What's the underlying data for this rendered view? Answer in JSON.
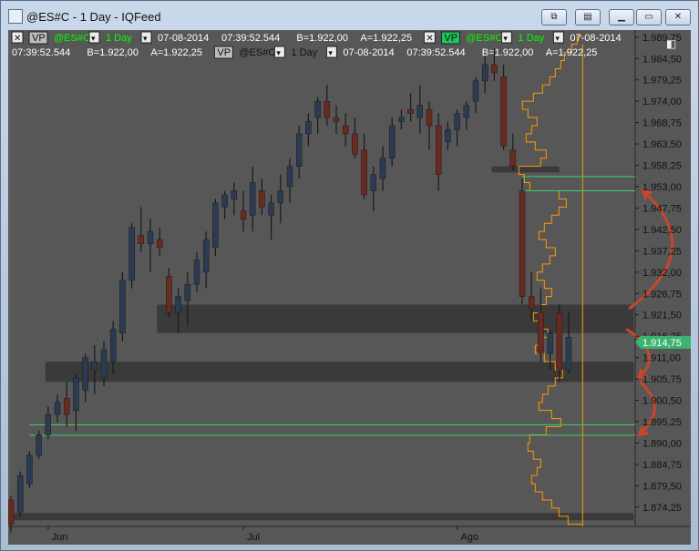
{
  "window": {
    "title": "@ES#C - 1 Day - IQFeed",
    "buttons": [
      "sync-link",
      "toolbar-toggle",
      "minimize",
      "restore",
      "close"
    ]
  },
  "legend": {
    "row1": [
      {
        "kind": "close-box",
        "text": "✕"
      },
      {
        "kind": "badge",
        "text": "VP",
        "style": "gray"
      },
      {
        "kind": "text",
        "text": "@ES#C",
        "color": "#00ff00"
      },
      {
        "kind": "dropdown",
        "text": "▾"
      },
      {
        "kind": "text",
        "text": "1 Day",
        "color": "#00ff00"
      },
      {
        "kind": "dropdown",
        "text": "▾"
      },
      {
        "kind": "text",
        "text": "07-08-2014",
        "color": "#ffffff"
      },
      {
        "kind": "text",
        "text": "07:39:52.544",
        "color": "#ffffff"
      },
      {
        "kind": "text",
        "text": "B=1.922,00",
        "color": "#ffffff"
      },
      {
        "kind": "text",
        "text": "A=1.922,25",
        "color": "#ffffff"
      },
      {
        "kind": "close-box",
        "text": "✕"
      },
      {
        "kind": "badge",
        "text": "VP",
        "style": "green"
      },
      {
        "kind": "text",
        "text": "@ES#C",
        "color": "#00ff00"
      },
      {
        "kind": "dropdown",
        "text": "▾"
      },
      {
        "kind": "text",
        "text": "1 Day",
        "color": "#00ff00"
      },
      {
        "kind": "dropdown",
        "text": "▾"
      },
      {
        "kind": "text",
        "text": "07-08-2014",
        "color": "#ffffff"
      }
    ],
    "row2": [
      {
        "kind": "text",
        "text": "07:39:52.544",
        "color": "#ffffff"
      },
      {
        "kind": "text",
        "text": "B=1.922,00",
        "color": "#ffffff"
      },
      {
        "kind": "text",
        "text": "A=1.922,25",
        "color": "#ffffff"
      },
      {
        "kind": "badge",
        "text": "VP",
        "style": "gray"
      },
      {
        "kind": "text",
        "text": "@ES#C",
        "color": "#111111"
      },
      {
        "kind": "dropdown",
        "text": "▾"
      },
      {
        "kind": "text",
        "text": "1 Day",
        "color": "#111111"
      },
      {
        "kind": "dropdown",
        "text": "▾"
      },
      {
        "kind": "text",
        "text": "07-08-2014",
        "color": "#ffffff"
      },
      {
        "kind": "text",
        "text": "07:39:52.544",
        "color": "#ffffff"
      },
      {
        "kind": "text",
        "text": "B=1.922,00",
        "color": "#ffffff"
      },
      {
        "kind": "text",
        "text": "A=1.922,25",
        "color": "#ffffff"
      }
    ],
    "panel_icon": "split-panel-icon"
  },
  "chart_data": {
    "type": "candlestick",
    "instrument": "@ES#C",
    "interval": "1 Day",
    "ylim": [
      1869.5,
      1991.5
    ],
    "y_ticks": [
      {
        "v": 1989.75,
        "label": "1.989,75"
      },
      {
        "v": 1984.5,
        "label": "1.984,50"
      },
      {
        "v": 1979.25,
        "label": "1.979,25"
      },
      {
        "v": 1974.0,
        "label": "1.974,00"
      },
      {
        "v": 1968.75,
        "label": "1.968,75"
      },
      {
        "v": 1963.5,
        "label": "1.963,50"
      },
      {
        "v": 1958.25,
        "label": "1.958,25"
      },
      {
        "v": 1953.0,
        "label": "1.953,00"
      },
      {
        "v": 1947.75,
        "label": "1.947,75"
      },
      {
        "v": 1942.5,
        "label": "1.942,50"
      },
      {
        "v": 1937.25,
        "label": "1.937,25"
      },
      {
        "v": 1932.0,
        "label": "1.932,00"
      },
      {
        "v": 1926.75,
        "label": "1.926,75"
      },
      {
        "v": 1921.5,
        "label": "1.921,50"
      },
      {
        "v": 1916.25,
        "label": "1.916,25"
      },
      {
        "v": 1911.0,
        "label": "1.911,00"
      },
      {
        "v": 1905.75,
        "label": "1.905,75"
      },
      {
        "v": 1900.5,
        "label": "1.900,50"
      },
      {
        "v": 1895.25,
        "label": "1.895,25"
      },
      {
        "v": 1890.0,
        "label": "1.890,00"
      },
      {
        "v": 1884.75,
        "label": "1.884,75"
      },
      {
        "v": 1879.5,
        "label": "1.879,50"
      },
      {
        "v": 1874.25,
        "label": "1.874,25"
      }
    ],
    "last_price": {
      "value": 1914.75,
      "label": "1.914,75",
      "color": "#3cb371"
    },
    "x_labels": [
      {
        "i": 4,
        "label": "Jun"
      },
      {
        "i": 25,
        "label": "Jul"
      },
      {
        "i": 48,
        "label": "Ago"
      }
    ],
    "candles": [
      [
        1876,
        1877,
        1868,
        1870
      ],
      [
        1873,
        1883,
        1872,
        1882
      ],
      [
        1880,
        1888,
        1879,
        1887
      ],
      [
        1887,
        1893,
        1886,
        1892
      ],
      [
        1892,
        1899,
        1891,
        1897
      ],
      [
        1897,
        1902,
        1895,
        1900
      ],
      [
        1901,
        1905,
        1894,
        1897
      ],
      [
        1898,
        1907,
        1893,
        1906
      ],
      [
        1903,
        1912,
        1900,
        1911
      ],
      [
        1908,
        1914,
        1902,
        1910
      ],
      [
        1906,
        1915,
        1904,
        1913
      ],
      [
        1910,
        1920,
        1907,
        1918
      ],
      [
        1917,
        1932,
        1915,
        1930
      ],
      [
        1930,
        1944,
        1928,
        1943
      ],
      [
        1941,
        1948,
        1937,
        1939
      ],
      [
        1939,
        1945,
        1932,
        1942
      ],
      [
        1940,
        1943,
        1936,
        1938
      ],
      [
        1931,
        1933,
        1921,
        1922
      ],
      [
        1922,
        1928,
        1917,
        1926
      ],
      [
        1925,
        1932,
        1919,
        1929
      ],
      [
        1929,
        1937,
        1927,
        1935
      ],
      [
        1932,
        1942,
        1928,
        1940
      ],
      [
        1938,
        1950,
        1936,
        1949
      ],
      [
        1948,
        1952,
        1945,
        1951
      ],
      [
        1950,
        1954,
        1946,
        1952
      ],
      [
        1947,
        1952,
        1942,
        1945
      ],
      [
        1946,
        1958,
        1942,
        1954
      ],
      [
        1952,
        1955,
        1946,
        1948
      ],
      [
        1946,
        1951,
        1940,
        1949
      ],
      [
        1949,
        1956,
        1944,
        1952
      ],
      [
        1953,
        1960,
        1949,
        1958
      ],
      [
        1958,
        1968,
        1955,
        1966
      ],
      [
        1966,
        1971,
        1963,
        1969
      ],
      [
        1970,
        1975,
        1966,
        1974
      ],
      [
        1974,
        1978,
        1968,
        1970
      ],
      [
        1970,
        1973,
        1966,
        1969
      ],
      [
        1968,
        1971,
        1963,
        1966
      ],
      [
        1966,
        1970,
        1960,
        1961
      ],
      [
        1962,
        1966,
        1950,
        1951
      ],
      [
        1952,
        1958,
        1947,
        1956
      ],
      [
        1955,
        1963,
        1952,
        1960
      ],
      [
        1960,
        1970,
        1958,
        1968
      ],
      [
        1969,
        1972,
        1967,
        1970
      ],
      [
        1972,
        1976,
        1969,
        1971
      ],
      [
        1970,
        1978,
        1966,
        1973
      ],
      [
        1972,
        1974,
        1962,
        1968
      ],
      [
        1968,
        1971,
        1952,
        1956
      ],
      [
        1964,
        1969,
        1962,
        1967
      ],
      [
        1967,
        1972,
        1963,
        1971
      ],
      [
        1970,
        1974,
        1967,
        1973
      ],
      [
        1974,
        1980,
        1971,
        1979
      ],
      [
        1979,
        1985,
        1976,
        1983
      ],
      [
        1983,
        1987,
        1979,
        1981
      ],
      [
        1980,
        1983,
        1962,
        1963
      ],
      [
        1962,
        1966,
        1957,
        1958
      ],
      [
        1952,
        1955,
        1924,
        1926
      ],
      [
        1926,
        1932,
        1920,
        1923
      ],
      [
        1922,
        1928,
        1910,
        1912
      ],
      [
        1912,
        1918,
        1908,
        1917
      ],
      [
        1922,
        1924,
        1905,
        1908
      ],
      [
        1908,
        1922,
        1907,
        1916
      ]
    ],
    "volume_profile": {
      "color": "#ff9900",
      "baseline_price": 1869.5,
      "profile": [
        [
          1870,
          16
        ],
        [
          1872,
          26
        ],
        [
          1874,
          34
        ],
        [
          1876,
          44
        ],
        [
          1878,
          52
        ],
        [
          1880,
          56
        ],
        [
          1882,
          50
        ],
        [
          1884,
          46
        ],
        [
          1886,
          54
        ],
        [
          1888,
          60
        ],
        [
          1890,
          58
        ],
        [
          1892,
          40
        ],
        [
          1894,
          24
        ],
        [
          1896,
          34
        ],
        [
          1898,
          48
        ],
        [
          1900,
          44
        ],
        [
          1902,
          38
        ],
        [
          1904,
          30
        ],
        [
          1906,
          22
        ],
        [
          1908,
          30
        ],
        [
          1910,
          42
        ],
        [
          1912,
          52
        ],
        [
          1914,
          44
        ],
        [
          1916,
          38
        ],
        [
          1918,
          48
        ],
        [
          1920,
          54
        ],
        [
          1922,
          46
        ],
        [
          1924,
          40
        ],
        [
          1926,
          34
        ],
        [
          1928,
          42
        ],
        [
          1930,
          50
        ],
        [
          1932,
          44
        ],
        [
          1934,
          36
        ],
        [
          1936,
          30
        ],
        [
          1938,
          40
        ],
        [
          1940,
          48
        ],
        [
          1942,
          42
        ],
        [
          1944,
          34
        ],
        [
          1946,
          26
        ],
        [
          1948,
          18
        ],
        [
          1950,
          26
        ],
        [
          1952,
          58
        ],
        [
          1954,
          64
        ],
        [
          1956,
          70
        ],
        [
          1958,
          46
        ],
        [
          1960,
          40
        ],
        [
          1962,
          52
        ],
        [
          1964,
          62
        ],
        [
          1966,
          56
        ],
        [
          1968,
          50
        ],
        [
          1970,
          60
        ],
        [
          1972,
          66
        ],
        [
          1974,
          54
        ],
        [
          1976,
          44
        ],
        [
          1978,
          36
        ],
        [
          1980,
          30
        ],
        [
          1982,
          24
        ],
        [
          1984,
          20
        ],
        [
          1986,
          12
        ],
        [
          1988,
          6
        ]
      ]
    },
    "zones": [
      {
        "from_index": 52,
        "to_index": 59,
        "top": 1958,
        "bottom": 1956.5,
        "color": "#3a3a3a"
      },
      {
        "from_index": 16,
        "to_index": 67,
        "top": 1924,
        "bottom": 1917,
        "color": "#3a3a3a"
      },
      {
        "from_index": 4,
        "to_index": 67,
        "top": 1910,
        "bottom": 1905,
        "color": "#3a3a3a"
      },
      {
        "from_index": 0,
        "to_index": 67,
        "top": 1872.8,
        "bottom": 1871,
        "color": "#3a3a3a"
      }
    ],
    "hlines": [
      {
        "price": 1955.5,
        "color": "#39d36a",
        "from_index": 55
      },
      {
        "price": 1952.0,
        "color": "#39d36a",
        "from_index": 55
      },
      {
        "price": 1894.5,
        "color": "#39d36a",
        "from_index": 2
      },
      {
        "price": 1891.9,
        "color": "#39d36a",
        "from_index": 2
      }
    ],
    "vline_index": 61.5,
    "arrows": [
      {
        "from": [
          1923,
          66.5
        ],
        "to": [
          1952,
          68
        ],
        "color": "#c8472a"
      },
      {
        "from": [
          1918,
          66.2
        ],
        "to": [
          1906,
          67.5
        ],
        "color": "#c8472a"
      },
      {
        "from": [
          1905,
          67.7
        ],
        "to": [
          1892,
          67.6
        ],
        "color": "#c8472a"
      }
    ]
  }
}
